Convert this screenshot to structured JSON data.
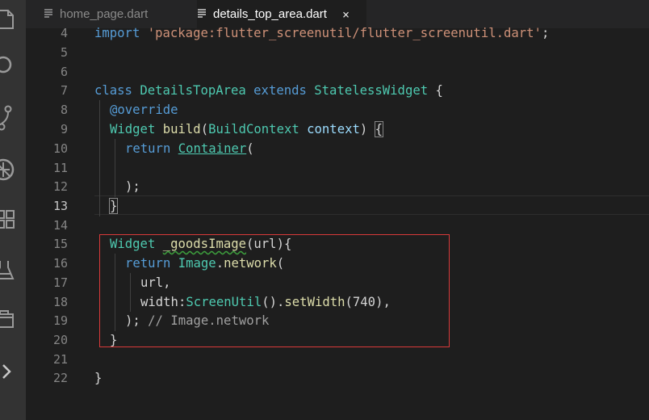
{
  "tabs": [
    {
      "label": "home_page.dart",
      "icon": "lines-file-icon"
    },
    {
      "label": "details_top_area.dart",
      "icon": "lines-file-icon",
      "close": "×"
    }
  ],
  "line_numbers": [
    "4",
    "5",
    "6",
    "7",
    "8",
    "9",
    "10",
    "11",
    "12",
    "13",
    "14",
    "15",
    "16",
    "17",
    "18",
    "19",
    "20",
    "21",
    "22"
  ],
  "active_line": "13",
  "code": {
    "l4": {
      "kw": "import",
      "sp": " ",
      "str": "'package:flutter_screenutil/flutter_screenutil.dart'",
      "end": ";"
    },
    "l7": {
      "kw": "class",
      "name": "DetailsTopArea",
      "ext": "extends",
      "base": "StatelessWidget",
      "brace": "{"
    },
    "l8": {
      "text": "@override"
    },
    "l9": {
      "type": "Widget",
      "fn": "build",
      "open": "(",
      "ptype": "BuildContext",
      "pname": "context",
      "close": ")",
      "brace": "{"
    },
    "l10": {
      "kw": "return",
      "type": "Container",
      "open": "("
    },
    "l12": {
      "text": ");"
    },
    "l13": {
      "text": "}"
    },
    "l15": {
      "type": "Widget",
      "fn": "_goodsImage",
      "args": "(url){"
    },
    "l16": {
      "kw": "return",
      "type": "Image",
      "dot": ".",
      "fn": "network",
      "open": "("
    },
    "l17": {
      "text": "url,"
    },
    "l18": {
      "prop": "width:",
      "type": "ScreenUtil",
      "call": "().",
      "fn": "setWidth",
      "args": "(740),"
    },
    "l19": {
      "text": ");",
      "comment": "// Image.network"
    },
    "l20": {
      "text": "}"
    },
    "l22": {
      "text": "}"
    }
  },
  "activity_bar": [
    "explorer-icon",
    "search-icon",
    "source-control-icon",
    "debug-icon",
    "extensions-icon",
    "testing-icon",
    "remote-icon",
    "chevron-right-icon"
  ],
  "colors": {
    "highlight": "#d93a3a",
    "keyword": "#569cd6",
    "type": "#4ec9b0",
    "string": "#ce9178",
    "function": "#dcdcaa"
  }
}
